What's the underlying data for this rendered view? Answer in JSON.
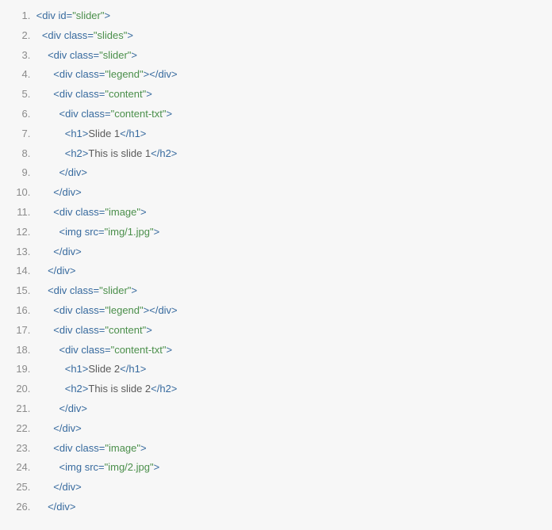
{
  "code": {
    "lines": [
      {
        "indent": 0,
        "tokens": [
          {
            "t": "tag",
            "v": "<div"
          },
          {
            "t": "txt",
            "v": " "
          },
          {
            "t": "attr",
            "v": "id"
          },
          {
            "t": "tag",
            "v": "="
          },
          {
            "t": "str",
            "v": "\"slider\""
          },
          {
            "t": "tag",
            "v": ">"
          }
        ]
      },
      {
        "indent": 1,
        "tokens": [
          {
            "t": "tag",
            "v": "<div"
          },
          {
            "t": "txt",
            "v": " "
          },
          {
            "t": "attr",
            "v": "class"
          },
          {
            "t": "tag",
            "v": "="
          },
          {
            "t": "str",
            "v": "\"slides\""
          },
          {
            "t": "tag",
            "v": ">"
          }
        ]
      },
      {
        "indent": 2,
        "tokens": [
          {
            "t": "tag",
            "v": "<div"
          },
          {
            "t": "txt",
            "v": " "
          },
          {
            "t": "attr",
            "v": "class"
          },
          {
            "t": "tag",
            "v": "="
          },
          {
            "t": "str",
            "v": "\"slider\""
          },
          {
            "t": "tag",
            "v": ">"
          }
        ]
      },
      {
        "indent": 3,
        "tokens": [
          {
            "t": "tag",
            "v": "<div"
          },
          {
            "t": "txt",
            "v": " "
          },
          {
            "t": "attr",
            "v": "class"
          },
          {
            "t": "tag",
            "v": "="
          },
          {
            "t": "str",
            "v": "\"legend\""
          },
          {
            "t": "tag",
            "v": ">"
          },
          {
            "t": "tag",
            "v": "</div>"
          }
        ]
      },
      {
        "indent": 3,
        "tokens": [
          {
            "t": "tag",
            "v": "<div"
          },
          {
            "t": "txt",
            "v": " "
          },
          {
            "t": "attr",
            "v": "class"
          },
          {
            "t": "tag",
            "v": "="
          },
          {
            "t": "str",
            "v": "\"content\""
          },
          {
            "t": "tag",
            "v": ">"
          }
        ]
      },
      {
        "indent": 4,
        "tokens": [
          {
            "t": "tag",
            "v": "<div"
          },
          {
            "t": "txt",
            "v": " "
          },
          {
            "t": "attr",
            "v": "class"
          },
          {
            "t": "tag",
            "v": "="
          },
          {
            "t": "str",
            "v": "\"content-txt\""
          },
          {
            "t": "tag",
            "v": ">"
          }
        ]
      },
      {
        "indent": 5,
        "tokens": [
          {
            "t": "tag",
            "v": "<h1>"
          },
          {
            "t": "txt",
            "v": "Slide 1"
          },
          {
            "t": "tag",
            "v": "</h1>"
          }
        ]
      },
      {
        "indent": 5,
        "tokens": [
          {
            "t": "tag",
            "v": "<h2>"
          },
          {
            "t": "txt",
            "v": "This is slide 1"
          },
          {
            "t": "tag",
            "v": "</h2>"
          }
        ]
      },
      {
        "indent": 4,
        "tokens": [
          {
            "t": "tag",
            "v": "</div>"
          }
        ]
      },
      {
        "indent": 3,
        "tokens": [
          {
            "t": "tag",
            "v": "</div>"
          }
        ]
      },
      {
        "indent": 3,
        "tokens": [
          {
            "t": "tag",
            "v": "<div"
          },
          {
            "t": "txt",
            "v": " "
          },
          {
            "t": "attr",
            "v": "class"
          },
          {
            "t": "tag",
            "v": "="
          },
          {
            "t": "str",
            "v": "\"image\""
          },
          {
            "t": "tag",
            "v": ">"
          }
        ]
      },
      {
        "indent": 4,
        "tokens": [
          {
            "t": "tag",
            "v": "<img"
          },
          {
            "t": "txt",
            "v": " "
          },
          {
            "t": "attr",
            "v": "src"
          },
          {
            "t": "tag",
            "v": "="
          },
          {
            "t": "str",
            "v": "\"img/1.jpg\""
          },
          {
            "t": "tag",
            "v": ">"
          }
        ]
      },
      {
        "indent": 3,
        "tokens": [
          {
            "t": "tag",
            "v": "</div>"
          }
        ]
      },
      {
        "indent": 2,
        "tokens": [
          {
            "t": "tag",
            "v": "</div>"
          }
        ]
      },
      {
        "indent": 2,
        "tokens": [
          {
            "t": "tag",
            "v": "<div"
          },
          {
            "t": "txt",
            "v": " "
          },
          {
            "t": "attr",
            "v": "class"
          },
          {
            "t": "tag",
            "v": "="
          },
          {
            "t": "str",
            "v": "\"slider\""
          },
          {
            "t": "tag",
            "v": ">"
          }
        ]
      },
      {
        "indent": 3,
        "tokens": [
          {
            "t": "tag",
            "v": "<div"
          },
          {
            "t": "txt",
            "v": " "
          },
          {
            "t": "attr",
            "v": "class"
          },
          {
            "t": "tag",
            "v": "="
          },
          {
            "t": "str",
            "v": "\"legend\""
          },
          {
            "t": "tag",
            "v": ">"
          },
          {
            "t": "tag",
            "v": "</div>"
          }
        ]
      },
      {
        "indent": 3,
        "tokens": [
          {
            "t": "tag",
            "v": "<div"
          },
          {
            "t": "txt",
            "v": " "
          },
          {
            "t": "attr",
            "v": "class"
          },
          {
            "t": "tag",
            "v": "="
          },
          {
            "t": "str",
            "v": "\"content\""
          },
          {
            "t": "tag",
            "v": ">"
          }
        ]
      },
      {
        "indent": 4,
        "tokens": [
          {
            "t": "tag",
            "v": "<div"
          },
          {
            "t": "txt",
            "v": " "
          },
          {
            "t": "attr",
            "v": "class"
          },
          {
            "t": "tag",
            "v": "="
          },
          {
            "t": "str",
            "v": "\"content-txt\""
          },
          {
            "t": "tag",
            "v": ">"
          }
        ]
      },
      {
        "indent": 5,
        "tokens": [
          {
            "t": "tag",
            "v": "<h1>"
          },
          {
            "t": "txt",
            "v": "Slide 2"
          },
          {
            "t": "tag",
            "v": "</h1>"
          }
        ]
      },
      {
        "indent": 5,
        "tokens": [
          {
            "t": "tag",
            "v": "<h2>"
          },
          {
            "t": "txt",
            "v": "This is slide 2"
          },
          {
            "t": "tag",
            "v": "</h2>"
          }
        ]
      },
      {
        "indent": 4,
        "tokens": [
          {
            "t": "tag",
            "v": "</div>"
          }
        ]
      },
      {
        "indent": 3,
        "tokens": [
          {
            "t": "tag",
            "v": "</div>"
          }
        ]
      },
      {
        "indent": 3,
        "tokens": [
          {
            "t": "tag",
            "v": "<div"
          },
          {
            "t": "txt",
            "v": " "
          },
          {
            "t": "attr",
            "v": "class"
          },
          {
            "t": "tag",
            "v": "="
          },
          {
            "t": "str",
            "v": "\"image\""
          },
          {
            "t": "tag",
            "v": ">"
          }
        ]
      },
      {
        "indent": 4,
        "tokens": [
          {
            "t": "tag",
            "v": "<img"
          },
          {
            "t": "txt",
            "v": " "
          },
          {
            "t": "attr",
            "v": "src"
          },
          {
            "t": "tag",
            "v": "="
          },
          {
            "t": "str",
            "v": "\"img/2.jpg\""
          },
          {
            "t": "tag",
            "v": ">"
          }
        ]
      },
      {
        "indent": 3,
        "tokens": [
          {
            "t": "tag",
            "v": "</div>"
          }
        ]
      },
      {
        "indent": 2,
        "tokens": [
          {
            "t": "tag",
            "v": "</div>"
          }
        ]
      }
    ]
  }
}
